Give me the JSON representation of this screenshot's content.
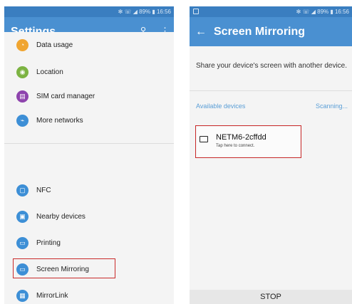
{
  "left": {
    "status": "✻ ☏ ◢ 89% ▮ 16:56",
    "title": "Settings",
    "search_glyph": "🔍",
    "more_glyph": "⋮",
    "items_top": [
      {
        "label": "Data usage",
        "icon": "data-usage-icon",
        "color": "#f0a531"
      },
      {
        "label": "Location",
        "icon": "location-icon",
        "color": "#7cb342"
      },
      {
        "label": "SIM card manager",
        "icon": "sim-card-icon",
        "color": "#8e44ad"
      },
      {
        "label": "More networks",
        "icon": "networks-icon",
        "color": "#3d8fd6"
      }
    ],
    "items_bottom": [
      {
        "label": "NFC",
        "icon": "nfc-icon",
        "color": "#3d8fd6"
      },
      {
        "label": "Nearby devices",
        "icon": "nearby-devices-icon",
        "color": "#3d8fd6"
      },
      {
        "label": "Printing",
        "icon": "printing-icon",
        "color": "#3d8fd6"
      },
      {
        "label": "Screen Mirroring",
        "icon": "screen-mirroring-icon",
        "color": "#3d8fd6"
      },
      {
        "label": "MirrorLink",
        "icon": "mirrorlink-icon",
        "color": "#3d8fd6"
      }
    ]
  },
  "right": {
    "status": "✻ ☏ ◢ 89% ▮ 16:56",
    "back_glyph": "←",
    "title": "Screen Mirroring",
    "description": "Share your device's screen with another device.",
    "available_label": "Available devices",
    "scanning_label": "Scanning...",
    "device": {
      "name": "NETM6-2cffdd",
      "hint": "Tap here to connect."
    },
    "stop_label": "STOP"
  },
  "colors": {
    "appbar": "#4a90d1",
    "statusbar": "#3a7ec0",
    "highlight": "#c92a2a"
  }
}
